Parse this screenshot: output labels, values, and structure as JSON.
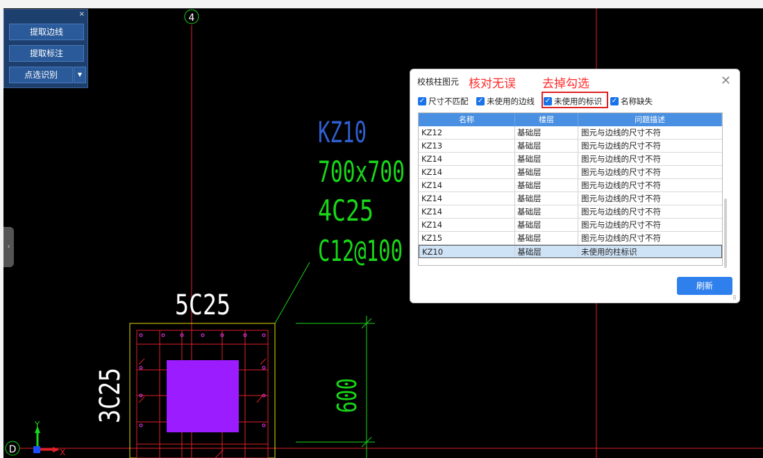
{
  "cad": {
    "axis_top": "4",
    "axis_left": "D",
    "column_name": "KZ10",
    "column_size": "700x700",
    "main_bars": "4C25",
    "stirrups": "C12@100",
    "top_bars": "5C25",
    "side_bars": "3C25",
    "dim": "600",
    "ucs_y": "Y",
    "ucs_x": "X"
  },
  "panel": {
    "close": "×",
    "buttons": [
      "提取边线",
      "提取标注",
      "点选识别"
    ],
    "dropdown": "▼"
  },
  "dialog": {
    "title": "校核柱图元",
    "close": "✕",
    "annotation1": "核对无误",
    "annotation2": "去掉勾选",
    "checkboxes": [
      "尺寸不匹配",
      "未使用的边线",
      "未使用的标识",
      "名称缺失"
    ],
    "columns": [
      "名称",
      "楼层",
      "问题描述"
    ],
    "rows": [
      [
        "KZ12",
        "基础层",
        "图元与边线的尺寸不符"
      ],
      [
        "KZ13",
        "基础层",
        "图元与边线的尺寸不符"
      ],
      [
        "KZ14",
        "基础层",
        "图元与边线的尺寸不符"
      ],
      [
        "KZ14",
        "基础层",
        "图元与边线的尺寸不符"
      ],
      [
        "KZ14",
        "基础层",
        "图元与边线的尺寸不符"
      ],
      [
        "KZ14",
        "基础层",
        "图元与边线的尺寸不符"
      ],
      [
        "KZ14",
        "基础层",
        "图元与边线的尺寸不符"
      ],
      [
        "KZ14",
        "基础层",
        "图元与边线的尺寸不符"
      ],
      [
        "KZ15",
        "基础层",
        "图元与边线的尺寸不符"
      ],
      [
        "KZ10",
        "基础层",
        "未使用的柱标识"
      ]
    ],
    "refresh": "刷新"
  },
  "colors": {
    "axis_red": "#e0202a",
    "rebar_green": "#18d818",
    "label_blue": "#2f5fd0",
    "column_purple": "#9b1cff",
    "outline_yellow": "#e8e000",
    "header_blue": "#4a90e2",
    "button_blue": "#2f80ed"
  }
}
